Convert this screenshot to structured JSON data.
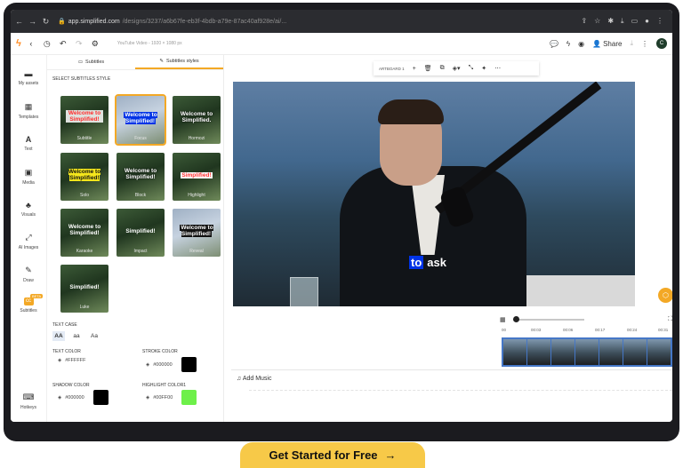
{
  "browser": {
    "url_domain": "app.simplified.com",
    "url_path": "/designs/3237/a6b67fe-eb3f-4bdb-a79e-87ac40af928e/ai/..."
  },
  "toolbar": {
    "doc_title": "YouTube Video - 1920 × 1080 px",
    "share_label": "Share",
    "avatar_initial": "C"
  },
  "sidebar": {
    "items": [
      {
        "label": "My assets",
        "icon": "folder-icon"
      },
      {
        "label": "Templates",
        "icon": "grid-icon"
      },
      {
        "label": "Text",
        "icon": "text-icon"
      },
      {
        "label": "Media",
        "icon": "image-icon"
      },
      {
        "label": "Visuals",
        "icon": "shapes-icon"
      },
      {
        "label": "AI Images",
        "icon": "magic-wand-icon"
      },
      {
        "label": "Draw",
        "icon": "pen-icon"
      },
      {
        "label": "Subtitles",
        "icon": "cc-icon",
        "badge": "BETA"
      },
      {
        "label": "Hotkeys",
        "icon": "keyboard-icon"
      }
    ]
  },
  "panel": {
    "tabs": [
      "Subtitles",
      "Subtitles styles"
    ],
    "section_title": "SELECT SUBTITLES STYLE",
    "styles": [
      {
        "name": "Subtitle",
        "text": "Welcome to Simplified!"
      },
      {
        "name": "Focus",
        "text": "Welcome to Simplified!"
      },
      {
        "name": "Hormozi",
        "text": "Welcome to Simplified."
      },
      {
        "name": "Solo",
        "text": "Welcome to Simplified!"
      },
      {
        "name": "Block",
        "text": "Welcome to Simplified!"
      },
      {
        "name": "Highlight",
        "text": "Simplified!"
      },
      {
        "name": "Karaoke",
        "text": "Welcome to Simplified!"
      },
      {
        "name": "Impact",
        "text": "Simplified!"
      },
      {
        "name": "Reveal",
        "text": "Welcome to Simplified!"
      },
      {
        "name": "Luke",
        "text": "Simplified!"
      }
    ],
    "text_case_label": "TEXT CASE",
    "case_options": [
      "AA",
      "aa",
      "Aa"
    ],
    "text_color_label": "TEXT COLOR",
    "text_color_value": "#FFFFFF",
    "stroke_color_label": "STROKE COLOR",
    "stroke_color_value": "#000000",
    "shadow_color_label": "SHADOW COLOR",
    "shadow_color_value": "#000000",
    "highlight_color_label": "HIGHLIGHT COLOR1",
    "highlight_color_value": "#00FF00"
  },
  "canvas": {
    "artboard_label": "ARTBOARD 1",
    "caption_highlight": "to",
    "caption_rest": "ask"
  },
  "timeline": {
    "ticks": [
      "00",
      "00:03",
      "00:06",
      "00:17",
      "00:24",
      "00:31"
    ],
    "music_label": "Add Music"
  },
  "cta": {
    "label": "Get Started for Free",
    "arrow": "→"
  },
  "colors": {
    "accent": "#f3a825",
    "highlight_blue": "#0033e6",
    "highlight_green": "#00ff00"
  }
}
